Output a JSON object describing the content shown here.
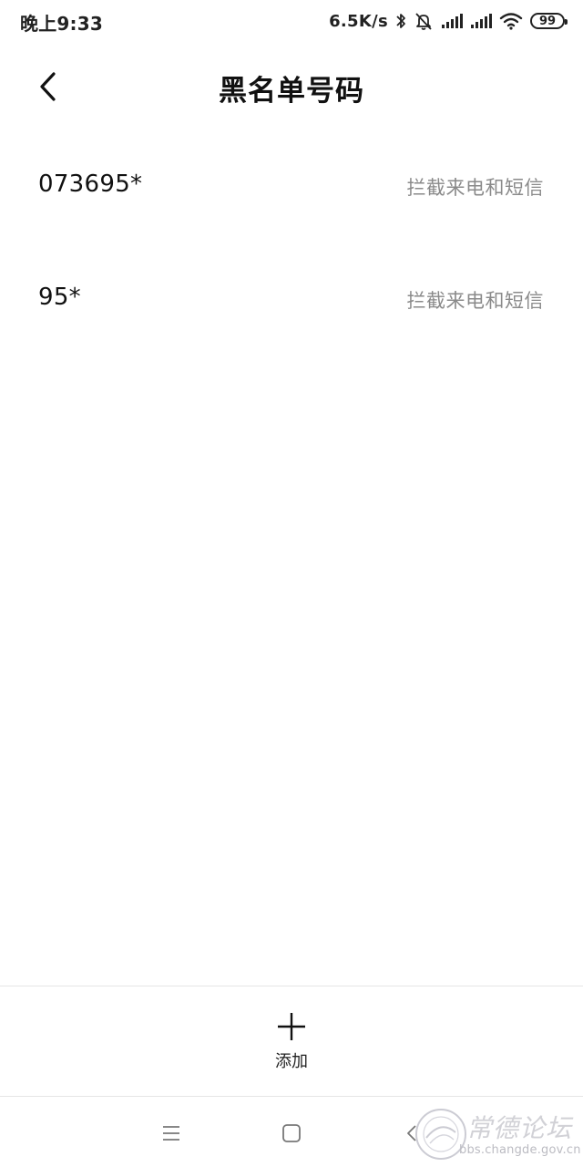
{
  "status_bar": {
    "time": "晚上9:33",
    "net_speed": "6.5K/s",
    "battery": "99",
    "icons": [
      "bluetooth-icon",
      "mute-icon",
      "signal-icon",
      "signal-icon",
      "wifi-icon",
      "battery-icon"
    ]
  },
  "header": {
    "title": "黑名单号码",
    "back_icon": "chevron-left-icon"
  },
  "blacklist": {
    "items": [
      {
        "number": "073695*",
        "status": "拦截来电和短信"
      },
      {
        "number": "95*",
        "status": "拦截来电和短信"
      }
    ]
  },
  "add_bar": {
    "label": "添加",
    "icon": "plus-icon"
  },
  "nav_bar": {
    "icons": [
      "menu-icon",
      "home-icon",
      "back-icon"
    ]
  },
  "watermark": {
    "title": "常德论坛",
    "url": "bbs.changde.gov.cn",
    "badge_text": "bbs.changde.gov.cn"
  },
  "colors": {
    "text_primary": "#111111",
    "text_secondary": "#8a8a8a",
    "divider": "#e6e6e6",
    "background": "#ffffff"
  }
}
